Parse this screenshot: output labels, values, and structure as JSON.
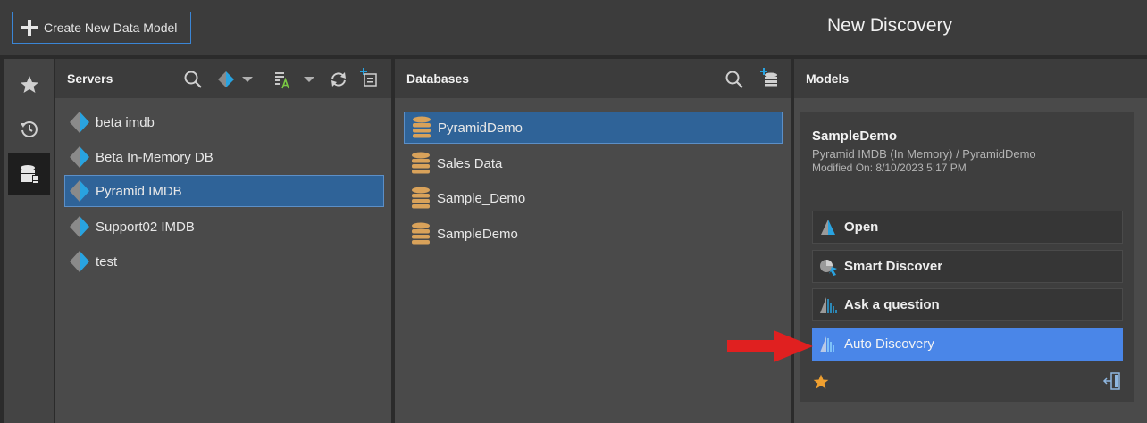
{
  "topbar": {
    "create_label": "Create New Data Model",
    "page_title": "New Discovery"
  },
  "leftnav": {
    "items": [
      "star-icon",
      "history-icon",
      "database-server-icon"
    ],
    "active": "database-server-icon"
  },
  "servers": {
    "title": "Servers",
    "items": [
      {
        "label": "beta imdb",
        "selected": false
      },
      {
        "label": "Beta In-Memory DB",
        "selected": false
      },
      {
        "label": "Pyramid IMDB",
        "selected": true
      },
      {
        "label": "Support02 IMDB",
        "selected": false
      },
      {
        "label": "test",
        "selected": false
      }
    ]
  },
  "databases": {
    "title": "Databases",
    "items": [
      {
        "label": "PyramidDemo",
        "selected": true
      },
      {
        "label": "Sales Data",
        "selected": false
      },
      {
        "label": "Sample_Demo",
        "selected": false
      },
      {
        "label": "SampleDemo",
        "selected": false
      }
    ]
  },
  "models": {
    "title": "Models",
    "card": {
      "name": "SampleDemo",
      "source": "Pyramid IMDB (In Memory) / PyramidDemo",
      "modified": "Modified On: 8/10/2023 5:17 PM",
      "actions": [
        {
          "label": "Open",
          "icon": "open-icon"
        },
        {
          "label": "Smart Discover",
          "icon": "smart-discover-icon"
        },
        {
          "label": "Ask a question",
          "icon": "ask-question-icon"
        },
        {
          "label": "Auto Discovery",
          "icon": "auto-discovery-icon",
          "highlighted": true
        }
      ]
    }
  },
  "colors": {
    "accent_blue": "#4a86e8",
    "selection_blue": "#2f6398",
    "card_border": "#d9a441",
    "arrow_red": "#e02020",
    "db_icon": "#d9a25a"
  }
}
